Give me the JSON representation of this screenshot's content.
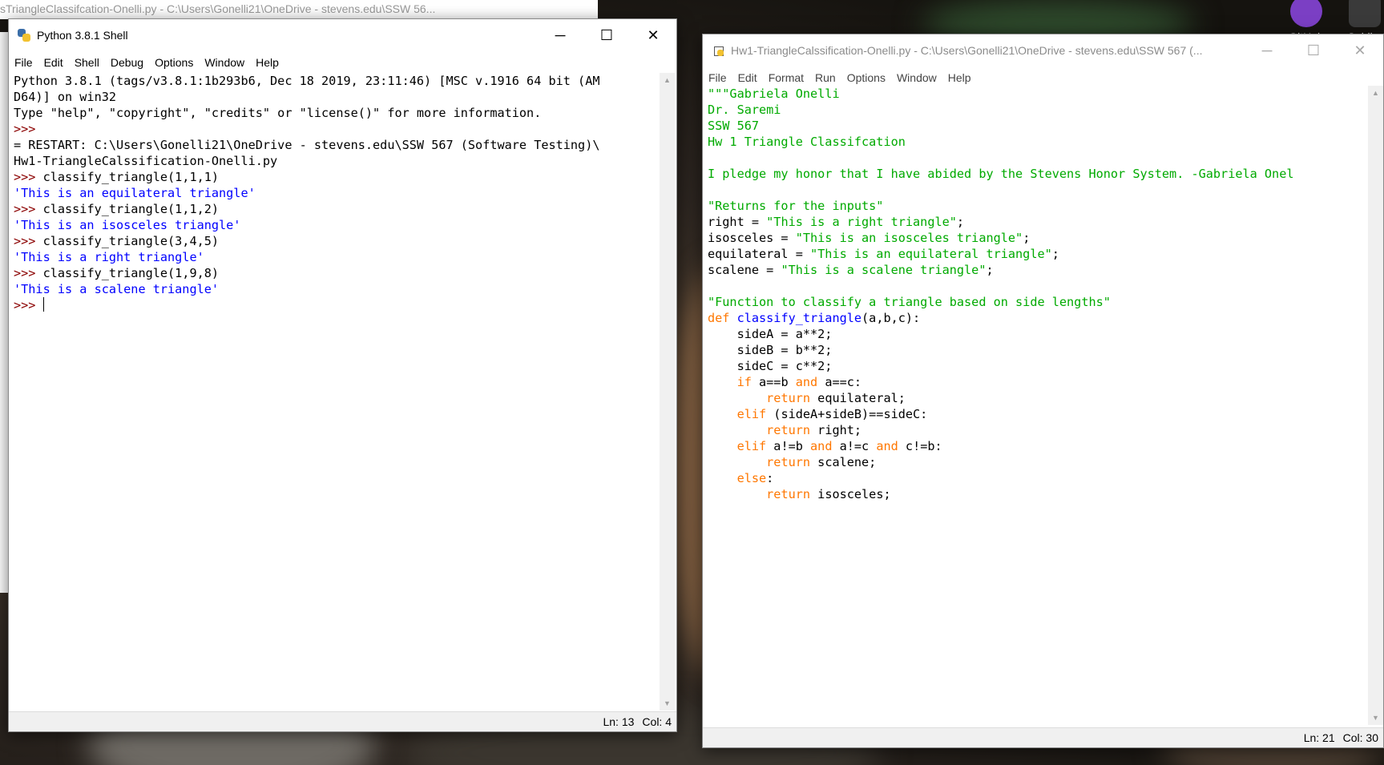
{
  "colors": {
    "string": "#00aa00",
    "keyword": "#ff7700",
    "definition": "#0000ff",
    "shell_output": "#0000ff",
    "prompt": "#8b0000",
    "accent_cyan": "#00a2d6"
  },
  "background_window": {
    "title": "sTriangleClassifcation-Onelli.py - C:\\Users\\Gonelli21\\OneDrive - stevens.edu\\SSW 56..."
  },
  "desktop_icons": [
    {
      "label": "GitHub",
      "icon": "github-icon"
    },
    {
      "label": "Sublim",
      "icon": "sublime-text-icon"
    }
  ],
  "shell": {
    "title": "Python 3.8.1 Shell",
    "icon": "python-idle-icon",
    "controls": {
      "minimize": "─",
      "maximize": "☐",
      "close": "✕"
    },
    "menu": [
      "File",
      "Edit",
      "Shell",
      "Debug",
      "Options",
      "Window",
      "Help"
    ],
    "lines": [
      [
        {
          "t": "Python 3.8.1 (tags/v3.8.1:1b293b6, Dec 18 2019, 23:11:46) [MSC v.1916 64 bit (AM",
          "c": "plain"
        }
      ],
      [
        {
          "t": "D64)] on win32",
          "c": "plain"
        }
      ],
      [
        {
          "t": "Type \"help\", \"copyright\", \"credits\" or \"license()\" for more information.",
          "c": "plain"
        }
      ],
      [
        {
          "t": ">>>",
          "c": "prompt"
        }
      ],
      [
        {
          "t": "= RESTART: C:\\Users\\Gonelli21\\OneDrive - stevens.edu\\SSW 567 (Software Testing)\\",
          "c": "plain"
        }
      ],
      [
        {
          "t": "Hw1-TriangleCalssification-Onelli.py",
          "c": "plain"
        }
      ],
      [
        {
          "t": ">>> ",
          "c": "prompt"
        },
        {
          "t": "classify_triangle(1,1,1)",
          "c": "plain"
        }
      ],
      [
        {
          "t": "'This is an equilateral triangle'",
          "c": "out"
        }
      ],
      [
        {
          "t": ">>> ",
          "c": "prompt"
        },
        {
          "t": "classify_triangle(1,1,2)",
          "c": "plain"
        }
      ],
      [
        {
          "t": "'This is an isosceles triangle'",
          "c": "out"
        }
      ],
      [
        {
          "t": ">>> ",
          "c": "prompt"
        },
        {
          "t": "classify_triangle(3,4,5)",
          "c": "plain"
        }
      ],
      [
        {
          "t": "'This is a right triangle'",
          "c": "out"
        }
      ],
      [
        {
          "t": ">>> ",
          "c": "prompt"
        },
        {
          "t": "classify_triangle(1,9,8)",
          "c": "plain"
        }
      ],
      [
        {
          "t": "'This is a scalene triangle'",
          "c": "out"
        }
      ],
      [
        {
          "t": ">>> ",
          "c": "prompt"
        },
        {
          "t": "",
          "c": "plain",
          "cursor": true
        }
      ]
    ],
    "status": {
      "ln": "Ln: 13",
      "col": "Col: 4"
    }
  },
  "editor": {
    "title": "Hw1-TriangleCalssification-Onelli.py - C:\\Users\\Gonelli21\\OneDrive - stevens.edu\\SSW 567 (...",
    "icon": "python-file-icon",
    "controls": {
      "minimize": "─",
      "maximize": "☐",
      "close": "✕"
    },
    "menu": [
      "File",
      "Edit",
      "Format",
      "Run",
      "Options",
      "Window",
      "Help"
    ],
    "lines": [
      [
        {
          "t": "\"\"\"Gabriela Onelli",
          "c": "str"
        }
      ],
      [
        {
          "t": "Dr. Saremi",
          "c": "str"
        }
      ],
      [
        {
          "t": "SSW 567",
          "c": "str"
        }
      ],
      [
        {
          "t": "Hw 1 Triangle Classifcation",
          "c": "str"
        }
      ],
      [
        {
          "t": "",
          "c": "plain"
        }
      ],
      [
        {
          "t": "I pledge my honor that I have abided by the Stevens Honor System. -Gabriela Onel",
          "c": "str"
        }
      ],
      [
        {
          "t": "",
          "c": "plain"
        }
      ],
      [
        {
          "t": "\"Returns for the inputs\"",
          "c": "str"
        }
      ],
      [
        {
          "t": "right = ",
          "c": "plain"
        },
        {
          "t": "\"This is a right triangle\"",
          "c": "str"
        },
        {
          "t": ";",
          "c": "plain"
        }
      ],
      [
        {
          "t": "isosceles = ",
          "c": "plain"
        },
        {
          "t": "\"This is an isosceles triangle\"",
          "c": "str"
        },
        {
          "t": ";",
          "c": "plain"
        }
      ],
      [
        {
          "t": "equilateral = ",
          "c": "plain"
        },
        {
          "t": "\"This is an equilateral triangle\"",
          "c": "str"
        },
        {
          "t": ";",
          "c": "plain"
        }
      ],
      [
        {
          "t": "scalene = ",
          "c": "plain"
        },
        {
          "t": "\"This is a scalene triangle\"",
          "c": "str"
        },
        {
          "t": ";",
          "c": "plain"
        }
      ],
      [
        {
          "t": "",
          "c": "plain"
        }
      ],
      [
        {
          "t": "\"Function to classify a triangle based on side lengths\"",
          "c": "str"
        }
      ],
      [
        {
          "t": "def ",
          "c": "kw"
        },
        {
          "t": "classify_triangle",
          "c": "def"
        },
        {
          "t": "(a,b,c):",
          "c": "plain"
        }
      ],
      [
        {
          "t": "    sideA = a**2;",
          "c": "plain"
        }
      ],
      [
        {
          "t": "    sideB = b**2;",
          "c": "plain"
        }
      ],
      [
        {
          "t": "    sideC = c**2;",
          "c": "plain"
        }
      ],
      [
        {
          "t": "    ",
          "c": "plain"
        },
        {
          "t": "if",
          "c": "kw"
        },
        {
          "t": " a==b ",
          "c": "plain"
        },
        {
          "t": "and",
          "c": "kw"
        },
        {
          "t": " a==c:",
          "c": "plain"
        }
      ],
      [
        {
          "t": "        ",
          "c": "plain"
        },
        {
          "t": "return",
          "c": "kw"
        },
        {
          "t": " equilateral;",
          "c": "plain"
        }
      ],
      [
        {
          "t": "    ",
          "c": "plain"
        },
        {
          "t": "elif",
          "c": "kw"
        },
        {
          "t": " (sideA+sideB)==sideC:",
          "c": "plain"
        }
      ],
      [
        {
          "t": "        ",
          "c": "plain"
        },
        {
          "t": "return",
          "c": "kw"
        },
        {
          "t": " right;",
          "c": "plain"
        }
      ],
      [
        {
          "t": "    ",
          "c": "plain"
        },
        {
          "t": "elif",
          "c": "kw"
        },
        {
          "t": " a!=b ",
          "c": "plain"
        },
        {
          "t": "and",
          "c": "kw"
        },
        {
          "t": " a!=c ",
          "c": "plain"
        },
        {
          "t": "and",
          "c": "kw"
        },
        {
          "t": " c!=b:",
          "c": "plain"
        }
      ],
      [
        {
          "t": "        ",
          "c": "plain"
        },
        {
          "t": "return",
          "c": "kw"
        },
        {
          "t": " scalene;",
          "c": "plain"
        }
      ],
      [
        {
          "t": "    ",
          "c": "plain"
        },
        {
          "t": "else",
          "c": "kw"
        },
        {
          "t": ":",
          "c": "plain"
        }
      ],
      [
        {
          "t": "        ",
          "c": "plain"
        },
        {
          "t": "return",
          "c": "kw"
        },
        {
          "t": " isosceles;",
          "c": "plain"
        }
      ]
    ],
    "status": {
      "ln": "Ln: 21",
      "col": "Col: 30"
    }
  }
}
